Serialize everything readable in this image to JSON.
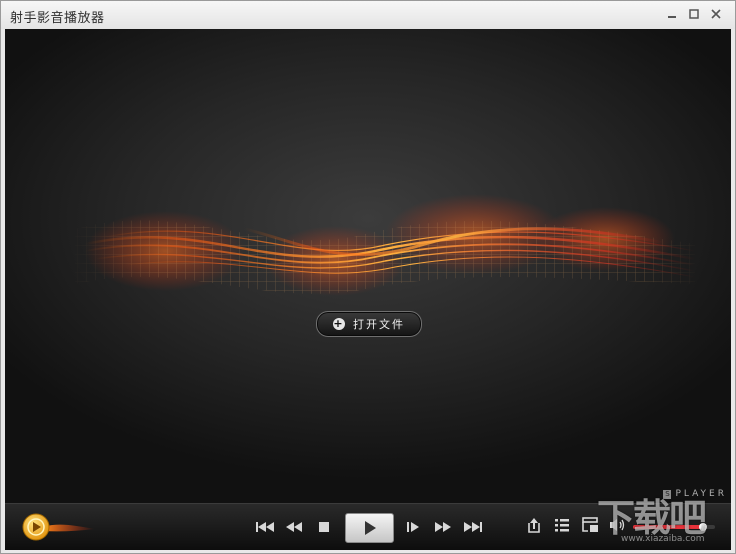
{
  "window": {
    "title": "射手影音播放器",
    "controls": {
      "minimize": "⸻",
      "maximize": "□",
      "close": "✕"
    }
  },
  "video": {
    "open_file_label": "打开文件",
    "open_file_icon": "plus-circle-icon",
    "player_logo_mark": "S",
    "player_logo_text": "PLAYER"
  },
  "controls": {
    "icons": {
      "previous": "skip-previous-icon",
      "rewind": "rewind-icon",
      "stop": "stop-icon",
      "play": "play-icon",
      "frame_step": "frame-step-icon",
      "fast_forward": "fast-forward-icon",
      "next": "skip-next-icon",
      "open": "eject-icon",
      "playlist": "playlist-icon",
      "screen": "screen-icon",
      "volume": "volume-icon"
    },
    "volume_level": 0.85
  },
  "watermark": {
    "text": "下载吧",
    "url": "www.xiazaiba.com"
  },
  "colors": {
    "accent_orange": "#ff8a1a",
    "accent_red": "#e8323a",
    "logo_gold": "#f6b418"
  }
}
